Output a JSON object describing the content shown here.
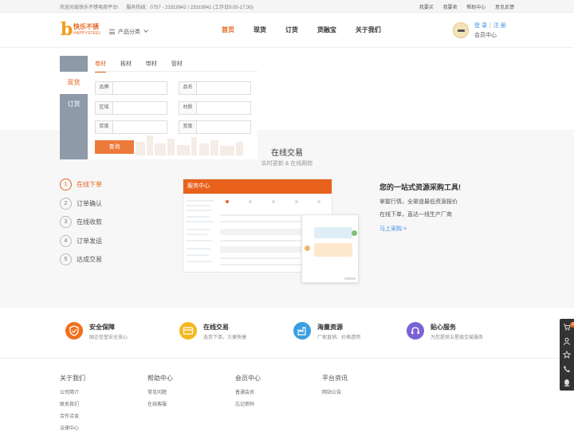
{
  "topbar": {
    "welcome": "欢迎光临快乐不锈电商平台!",
    "hotline": "服务热线：0757 - 23319942 / 23319941 (工作日9:00-17:30)",
    "links": [
      "我要买",
      "我要卖",
      "帮助中心",
      "意见反馈"
    ]
  },
  "header": {
    "logo_cn": "快乐不锈",
    "logo_en": "HAPPYSTEEL",
    "category_label": "产品分类",
    "nav": [
      "首页",
      "现货",
      "订货",
      "货融宝",
      "关于我们"
    ],
    "login": "登 录",
    "register": "注 册",
    "member_center": "会员中心"
  },
  "search": {
    "side_tabs": [
      "现货",
      "订货"
    ],
    "tabs": [
      "卷材",
      "板材",
      "带材",
      "管材"
    ],
    "fields": [
      {
        "label": "品牌",
        "value": ""
      },
      {
        "label": "品名",
        "value": ""
      },
      {
        "label": "区域",
        "value": ""
      },
      {
        "label": "材质",
        "value": ""
      },
      {
        "label": "厚度",
        "value": ""
      },
      {
        "label": "宽度",
        "value": ""
      }
    ],
    "query_button": "查询"
  },
  "trade": {
    "title": "在线交易",
    "subtitle": "实时更新 & 在线跟踪",
    "steps": [
      {
        "num": "1",
        "label": "在线下单"
      },
      {
        "num": "2",
        "label": "订单确认"
      },
      {
        "num": "3",
        "label": "在线收款"
      },
      {
        "num": "4",
        "label": "订单发运"
      },
      {
        "num": "5",
        "label": "达成交易"
      }
    ],
    "mock_title": "服务中心",
    "promo_title": "您的一站式资源采购工具!",
    "promo_line1": "掌握行情，全渠道最低资源报价",
    "promo_line2": "在线下单，直达一线生产厂商",
    "promo_link": "马上采购 >"
  },
  "features": [
    {
      "title": "安全保障",
      "desc": "国企信誉安全放心",
      "color": "#f0701e",
      "icon": "shield-icon"
    },
    {
      "title": "在线交易",
      "desc": "选货下单，方便快捷",
      "color": "#f5b820",
      "icon": "card-icon"
    },
    {
      "title": "海量资源",
      "desc": "厂家直销、价格透明",
      "color": "#3a9ee0",
      "icon": "factory-icon"
    },
    {
      "title": "贴心服务",
      "desc": "为您提供五星级交易服务",
      "color": "#7b63d6",
      "icon": "headset-icon"
    }
  ],
  "footer": {
    "columns": [
      {
        "title": "关于我们",
        "links": [
          "公司简介",
          "联系我们",
          "合作洽谈",
          "法律中心"
        ]
      },
      {
        "title": "帮助中心",
        "links": [
          "常见问题",
          "在线客服"
        ]
      },
      {
        "title": "会员中心",
        "links": [
          "普通会员",
          "忘记密码"
        ]
      },
      {
        "title": "平台资讯",
        "links": [
          "网站公告"
        ]
      }
    ]
  },
  "float": {
    "cart_count": "0"
  },
  "colors": {
    "brand": "#e8621c",
    "link": "#3a8ee6"
  }
}
